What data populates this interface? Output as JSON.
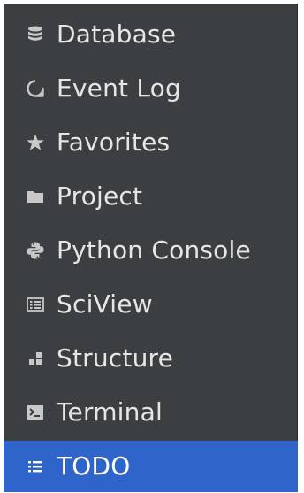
{
  "menu": {
    "items": [
      {
        "label": "Database",
        "icon": "database-icon",
        "selected": false
      },
      {
        "label": "Event Log",
        "icon": "event-log-icon",
        "selected": false
      },
      {
        "label": "Favorites",
        "icon": "star-icon",
        "selected": false
      },
      {
        "label": "Project",
        "icon": "folder-icon",
        "selected": false
      },
      {
        "label": "Python Console",
        "icon": "python-icon",
        "selected": false
      },
      {
        "label": "SciView",
        "icon": "sciview-icon",
        "selected": false
      },
      {
        "label": "Structure",
        "icon": "structure-icon",
        "selected": false
      },
      {
        "label": "Terminal",
        "icon": "terminal-icon",
        "selected": false
      },
      {
        "label": "TODO",
        "icon": "todo-icon",
        "selected": true
      }
    ]
  },
  "colors": {
    "panel_background": "#3c3f41",
    "selected_background": "#2f65ca",
    "text": "#e6e6e6",
    "icon": "#c8c8c8"
  }
}
